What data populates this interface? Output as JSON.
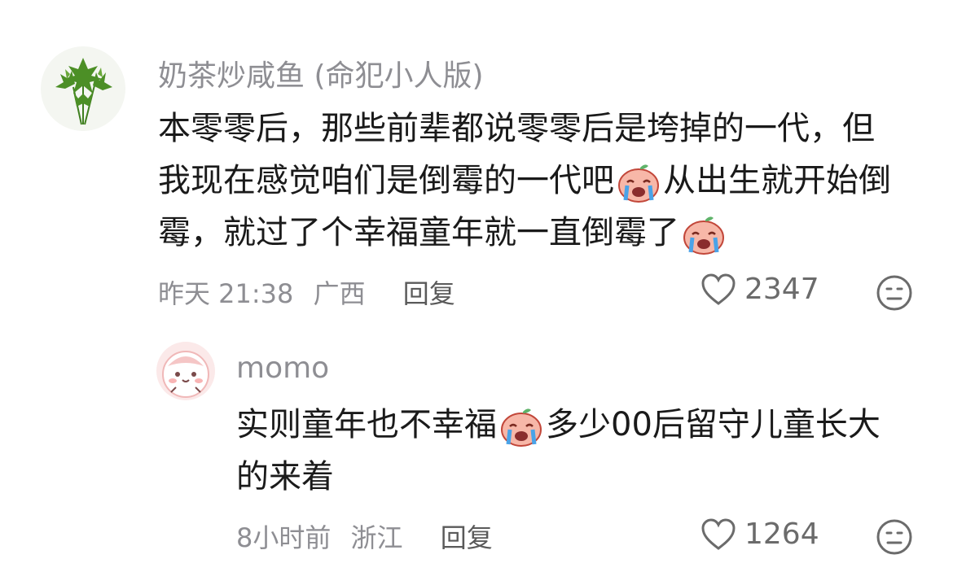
{
  "comments": [
    {
      "author": "奶茶炒咸鱼 (命犯小人版)",
      "text_lines": [
        "本零零后，那些前辈都说零零后是垮掉的一代，但",
        "我现在感觉咱们是倒霉的一代吧",
        "从出生就开始倒",
        "霉，就过了个幸福童年就一直倒霉了"
      ],
      "time": "昨天 21:38",
      "location": "广西",
      "reply_label": "回复",
      "likes": "2347",
      "avatar_icon": "herb-plant-icon",
      "inline_emoji": "crying-sticker-icon"
    },
    {
      "author": "momo",
      "text_lines": [
        "实则童年也不幸福",
        "多少00后留守儿童长大",
        "的来着"
      ],
      "time": "8小时前",
      "location": "浙江",
      "reply_label": "回复",
      "likes": "1264",
      "avatar_icon": "pink-cute-character-icon",
      "inline_emoji": "crying-sticker-icon"
    }
  ],
  "colors": {
    "meta_gray": "#8e8e93",
    "text": "#1a1a1a",
    "avatar_pink": "#f5c6c6"
  }
}
